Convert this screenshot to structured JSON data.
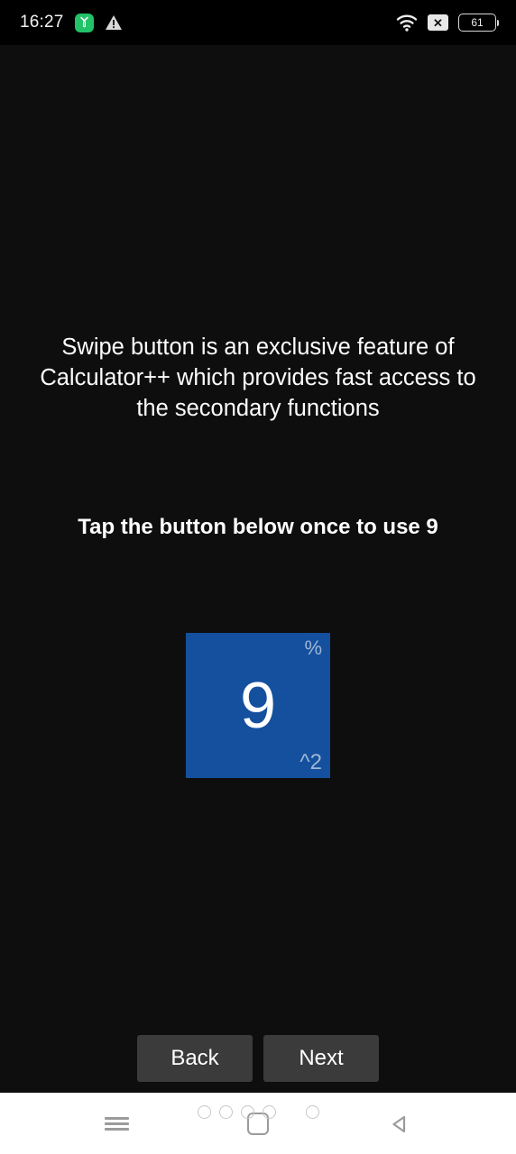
{
  "statusbar": {
    "time": "16:27",
    "icons": {
      "app_icon": "green-app-icon",
      "warning": "warning-triangle-icon",
      "wifi": "wifi-icon",
      "no_sim": "no-sim-icon",
      "no_sim_glyph": "✕",
      "battery": "battery-icon",
      "battery_level": "61"
    }
  },
  "tutorial": {
    "description": "Swipe button is an exclusive feature of Calculator++ which provides fast access to the secondary functions",
    "instruction": "Tap the button below once to use 9"
  },
  "calc_button": {
    "digit": "9",
    "top_right": "%",
    "bottom_right": "^2",
    "background": "#14509e",
    "digit_color": "#ffffff",
    "corner_color": "#9fb6d4"
  },
  "nav": {
    "back_label": "Back",
    "next_label": "Next",
    "button_bg": "#3b3b3b"
  },
  "pager": {
    "total": 6,
    "active_index": 4
  },
  "systemnav": {
    "recents": "recents-menu-icon",
    "home": "home-square-icon",
    "back": "back-triangle-icon"
  }
}
